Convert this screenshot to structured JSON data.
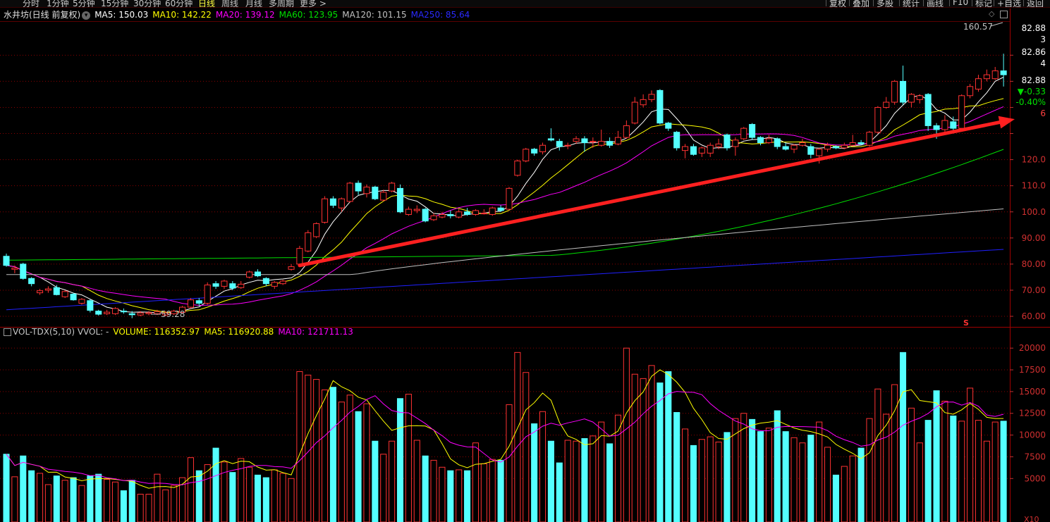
{
  "toolbar": {
    "periods": [
      "分时",
      "1分钟",
      "5分钟",
      "15分钟",
      "30分钟",
      "60分钟",
      "日线",
      "周线",
      "月线",
      "多周期",
      "更多 >"
    ],
    "active_period": "日线",
    "buttons": [
      "复权",
      "叠加",
      "多股",
      "统计",
      "画线",
      "F10",
      "标记",
      "+自选",
      "返回"
    ]
  },
  "main_info": {
    "title": "水井坊(日线 前复权)",
    "ma5": "MA5: 150.03",
    "ma10": "MA10: 142.22",
    "ma20": "MA20: 139.12",
    "ma60": "MA60: 123.95",
    "ma120": "MA120: 101.15",
    "ma250": "MA250: 85.64"
  },
  "vol_info": {
    "title": "VOL-TDX(5,10) VVOL: -",
    "volume": "VOLUME: 116352.97",
    "ma5": "MA5: 116920.88",
    "ma10": "MA10: 121711.13"
  },
  "annotations": {
    "high_label": "160.57",
    "low_label": "59.28",
    "signal_mark": "S"
  },
  "price_axis": {
    "right_labels_top": [
      "82.88",
      "3",
      "82.86",
      "4"
    ],
    "quote_price": "82.88",
    "quote_change": "▼-0.33",
    "quote_pct": "-0.40%",
    "quote_extra": "6",
    "ticks": [
      "120.0",
      "110.0",
      "100.0",
      "90.00",
      "80.00",
      "70.00",
      "60.00"
    ]
  },
  "vol_axis": {
    "ticks": [
      "20000",
      "17500",
      "15000",
      "12500",
      "10000",
      "7500",
      "5000"
    ],
    "unit": "X10"
  },
  "colors": {
    "up": "#ff3232",
    "down": "#54ffff",
    "ma5": "#ffffff",
    "ma10": "#ffff00",
    "ma20": "#ff00ff",
    "ma60": "#00e000",
    "ma120": "#c0c0c0",
    "ma250": "#2020ff",
    "grid": "#8b0000",
    "trend_arrow": "#ff2020"
  },
  "chart_data": {
    "type": "candlestick",
    "price_ylim": [
      56.5,
      172.5
    ],
    "volume_ylim": [
      0,
      20500
    ],
    "candles": [
      {
        "o": 83.0,
        "c": 79.5,
        "h": 84.0,
        "l": 79.0,
        "v": 7800
      },
      {
        "o": 78.0,
        "c": 78.5,
        "h": 79.5,
        "l": 76.5,
        "v": 5200
      },
      {
        "o": 80.0,
        "c": 74.5,
        "h": 80.5,
        "l": 74.0,
        "v": 7600
      },
      {
        "o": 74.5,
        "c": 72.5,
        "h": 75.0,
        "l": 71.5,
        "v": 5900
      },
      {
        "o": 69.0,
        "c": 69.8,
        "h": 70.5,
        "l": 68.2,
        "v": 5600
      },
      {
        "o": 70.0,
        "c": 70.5,
        "h": 71.5,
        "l": 69.0,
        "v": 4300
      },
      {
        "o": 71.0,
        "c": 68.3,
        "h": 72.0,
        "l": 68.0,
        "v": 5300
      },
      {
        "o": 67.5,
        "c": 69.5,
        "h": 70.0,
        "l": 67.0,
        "v": 4800
      },
      {
        "o": 68.5,
        "c": 66.3,
        "h": 69.0,
        "l": 66.0,
        "v": 5100
      },
      {
        "o": 65.0,
        "c": 66.5,
        "h": 67.0,
        "l": 64.5,
        "v": 4200
      },
      {
        "o": 66.0,
        "c": 62.3,
        "h": 66.5,
        "l": 61.5,
        "v": 5300
      },
      {
        "o": 62.0,
        "c": 60.8,
        "h": 62.5,
        "l": 60.3,
        "v": 5500
      },
      {
        "o": 61.0,
        "c": 61.6,
        "h": 62.5,
        "l": 60.5,
        "v": 4900
      },
      {
        "o": 61.0,
        "c": 63.0,
        "h": 63.5,
        "l": 60.5,
        "v": 4600
      },
      {
        "o": 62.0,
        "c": 61.7,
        "h": 63.0,
        "l": 61.0,
        "v": 3600
      },
      {
        "o": 61.0,
        "c": 60.6,
        "h": 62.0,
        "l": 59.3,
        "v": 4800
      },
      {
        "o": 60.5,
        "c": 61.3,
        "h": 62.0,
        "l": 60.0,
        "v": 3200
      },
      {
        "o": 61.0,
        "c": 61.4,
        "h": 62.0,
        "l": 60.4,
        "v": 3200
      },
      {
        "o": 61.0,
        "c": 61.8,
        "h": 62.5,
        "l": 60.5,
        "v": 5500
      },
      {
        "o": 60.5,
        "c": 61.3,
        "h": 62.0,
        "l": 60.0,
        "v": 3700
      },
      {
        "o": 61.0,
        "c": 62.0,
        "h": 62.5,
        "l": 60.5,
        "v": 4200
      },
      {
        "o": 61.5,
        "c": 63.5,
        "h": 64.0,
        "l": 61.0,
        "v": 5100
      },
      {
        "o": 63.5,
        "c": 66.3,
        "h": 67.0,
        "l": 63.0,
        "v": 7400
      },
      {
        "o": 66.0,
        "c": 65.0,
        "h": 67.0,
        "l": 64.0,
        "v": 5900
      },
      {
        "o": 65.0,
        "c": 72.0,
        "h": 73.0,
        "l": 64.5,
        "v": 6600
      },
      {
        "o": 72.5,
        "c": 71.5,
        "h": 73.5,
        "l": 70.5,
        "v": 8500
      },
      {
        "o": 71.5,
        "c": 73.5,
        "h": 74.0,
        "l": 70.5,
        "v": 6900
      },
      {
        "o": 72.5,
        "c": 70.8,
        "h": 73.5,
        "l": 70.0,
        "v": 5700
      },
      {
        "o": 71.0,
        "c": 72.3,
        "h": 73.5,
        "l": 70.5,
        "v": 7300
      },
      {
        "o": 75.0,
        "c": 77.0,
        "h": 77.5,
        "l": 74.5,
        "v": 6300
      },
      {
        "o": 77.0,
        "c": 75.5,
        "h": 78.0,
        "l": 75.0,
        "v": 5400
      },
      {
        "o": 74.5,
        "c": 72.5,
        "h": 75.0,
        "l": 71.5,
        "v": 5100
      },
      {
        "o": 71.5,
        "c": 73.0,
        "h": 73.5,
        "l": 70.5,
        "v": 6000
      },
      {
        "o": 72.5,
        "c": 73.5,
        "h": 74.0,
        "l": 72.0,
        "v": 5600
      },
      {
        "o": 78.0,
        "c": 79.0,
        "h": 80.0,
        "l": 77.5,
        "v": 5000
      },
      {
        "o": 80.0,
        "c": 86.0,
        "h": 87.0,
        "l": 79.5,
        "v": 17300
      },
      {
        "o": 85.0,
        "c": 92.0,
        "h": 93.0,
        "l": 84.5,
        "v": 16900
      },
      {
        "o": 90.5,
        "c": 95.5,
        "h": 96.0,
        "l": 90.0,
        "v": 16400
      },
      {
        "o": 96.0,
        "c": 105.0,
        "h": 106.0,
        "l": 95.5,
        "v": 15200
      },
      {
        "o": 105.0,
        "c": 102.5,
        "h": 106.0,
        "l": 101.5,
        "v": 15500
      },
      {
        "o": 101.5,
        "c": 105.0,
        "h": 105.5,
        "l": 100.0,
        "v": 13800
      },
      {
        "o": 104.0,
        "c": 111.0,
        "h": 111.5,
        "l": 103.5,
        "v": 14600
      },
      {
        "o": 111.0,
        "c": 108.0,
        "h": 112.0,
        "l": 106.5,
        "v": 12700
      },
      {
        "o": 107.0,
        "c": 109.5,
        "h": 110.5,
        "l": 105.5,
        "v": 13600
      },
      {
        "o": 109.5,
        "c": 105.0,
        "h": 110.0,
        "l": 104.5,
        "v": 9300
      },
      {
        "o": 104.5,
        "c": 107.5,
        "h": 108.5,
        "l": 104.0,
        "v": 7800
      },
      {
        "o": 108.0,
        "c": 111.0,
        "h": 111.5,
        "l": 107.5,
        "v": 9300
      },
      {
        "o": 109.0,
        "c": 100.0,
        "h": 110.5,
        "l": 99.5,
        "v": 14200
      },
      {
        "o": 99.0,
        "c": 101.0,
        "h": 102.0,
        "l": 98.5,
        "v": 14700
      },
      {
        "o": 100.5,
        "c": 101.0,
        "h": 102.5,
        "l": 99.5,
        "v": 9400
      },
      {
        "o": 101.0,
        "c": 96.5,
        "h": 101.5,
        "l": 96.0,
        "v": 7600
      },
      {
        "o": 97.0,
        "c": 98.5,
        "h": 99.5,
        "l": 96.5,
        "v": 7100
      },
      {
        "o": 98.0,
        "c": 99.0,
        "h": 100.0,
        "l": 97.5,
        "v": 6300
      },
      {
        "o": 99.0,
        "c": 98.5,
        "h": 100.5,
        "l": 97.5,
        "v": 5900
      },
      {
        "o": 98.0,
        "c": 100.0,
        "h": 101.0,
        "l": 97.5,
        "v": 6000
      },
      {
        "o": 100.0,
        "c": 99.0,
        "h": 101.5,
        "l": 98.5,
        "v": 5900
      },
      {
        "o": 99.0,
        "c": 100.5,
        "h": 101.0,
        "l": 98.5,
        "v": 9100
      },
      {
        "o": 99.5,
        "c": 99.5,
        "h": 101.0,
        "l": 99.0,
        "v": 6700
      },
      {
        "o": 99.0,
        "c": 101.5,
        "h": 102.0,
        "l": 98.5,
        "v": 7200
      },
      {
        "o": 101.5,
        "c": 100.5,
        "h": 102.5,
        "l": 100.0,
        "v": 7100
      },
      {
        "o": 101.0,
        "c": 109.0,
        "h": 109.5,
        "l": 100.5,
        "v": 13500
      },
      {
        "o": 114.0,
        "c": 119.5,
        "h": 120.0,
        "l": 113.5,
        "v": 19500
      },
      {
        "o": 119.5,
        "c": 124.0,
        "h": 124.5,
        "l": 119.0,
        "v": 17200
      },
      {
        "o": 124.0,
        "c": 122.5,
        "h": 124.5,
        "l": 121.5,
        "v": 11300
      },
      {
        "o": 123.0,
        "c": 125.5,
        "h": 126.5,
        "l": 122.0,
        "v": 12700
      },
      {
        "o": 128.0,
        "c": 127.5,
        "h": 132.0,
        "l": 127.0,
        "v": 9300
      },
      {
        "o": 127.0,
        "c": 125.0,
        "h": 128.0,
        "l": 123.5,
        "v": 6800
      },
      {
        "o": 125.5,
        "c": 125.5,
        "h": 126.5,
        "l": 124.0,
        "v": 9400
      },
      {
        "o": 127.0,
        "c": 128.0,
        "h": 129.0,
        "l": 126.0,
        "v": 9300
      },
      {
        "o": 128.0,
        "c": 126.5,
        "h": 129.0,
        "l": 123.0,
        "v": 9600
      },
      {
        "o": 127.0,
        "c": 127.0,
        "h": 128.5,
        "l": 124.5,
        "v": 9900
      },
      {
        "o": 125.5,
        "c": 127.0,
        "h": 131.5,
        "l": 125.0,
        "v": 11500
      },
      {
        "o": 127.0,
        "c": 125.5,
        "h": 128.5,
        "l": 124.5,
        "v": 9000
      },
      {
        "o": 126.0,
        "c": 128.5,
        "h": 131.0,
        "l": 125.5,
        "v": 12300
      },
      {
        "o": 128.5,
        "c": 133.0,
        "h": 135.0,
        "l": 128.0,
        "v": 20000
      },
      {
        "o": 134.0,
        "c": 142.0,
        "h": 144.0,
        "l": 133.5,
        "v": 17000
      },
      {
        "o": 141.0,
        "c": 143.0,
        "h": 145.0,
        "l": 140.0,
        "v": 16500
      },
      {
        "o": 143.0,
        "c": 145.0,
        "h": 146.5,
        "l": 142.0,
        "v": 18000
      },
      {
        "o": 146.5,
        "c": 134.0,
        "h": 147.0,
        "l": 133.5,
        "v": 16000
      },
      {
        "o": 134.0,
        "c": 132.0,
        "h": 134.5,
        "l": 131.0,
        "v": 17300
      },
      {
        "o": 130.5,
        "c": 124.5,
        "h": 131.0,
        "l": 123.5,
        "v": 12600
      },
      {
        "o": 123.5,
        "c": 125.0,
        "h": 126.0,
        "l": 120.5,
        "v": 10700
      },
      {
        "o": 125.0,
        "c": 122.0,
        "h": 126.0,
        "l": 121.5,
        "v": 8800
      },
      {
        "o": 122.5,
        "c": 124.5,
        "h": 125.0,
        "l": 121.0,
        "v": 9500
      },
      {
        "o": 122.5,
        "c": 125.5,
        "h": 126.5,
        "l": 121.0,
        "v": 9800
      },
      {
        "o": 125.0,
        "c": 126.0,
        "h": 128.0,
        "l": 124.0,
        "v": 9200
      },
      {
        "o": 129.5,
        "c": 124.5,
        "h": 130.0,
        "l": 123.5,
        "v": 10300
      },
      {
        "o": 125.0,
        "c": 127.5,
        "h": 128.5,
        "l": 121.5,
        "v": 11900
      },
      {
        "o": 128.0,
        "c": 132.0,
        "h": 132.5,
        "l": 127.5,
        "v": 12500
      },
      {
        "o": 133.5,
        "c": 128.5,
        "h": 134.0,
        "l": 127.5,
        "v": 11800
      },
      {
        "o": 128.5,
        "c": 126.5,
        "h": 129.0,
        "l": 125.5,
        "v": 10400
      },
      {
        "o": 126.5,
        "c": 128.0,
        "h": 129.5,
        "l": 126.0,
        "v": 10800
      },
      {
        "o": 128.0,
        "c": 125.0,
        "h": 128.5,
        "l": 124.0,
        "v": 12800
      },
      {
        "o": 125.0,
        "c": 124.0,
        "h": 126.5,
        "l": 123.5,
        "v": 10400
      },
      {
        "o": 124.0,
        "c": 125.5,
        "h": 126.0,
        "l": 122.5,
        "v": 9700
      },
      {
        "o": 125.5,
        "c": 126.5,
        "h": 128.0,
        "l": 125.0,
        "v": 9100
      },
      {
        "o": 125.0,
        "c": 122.0,
        "h": 126.0,
        "l": 120.5,
        "v": 10000
      },
      {
        "o": 121.5,
        "c": 124.0,
        "h": 124.5,
        "l": 118.5,
        "v": 11500
      },
      {
        "o": 124.0,
        "c": 125.5,
        "h": 126.5,
        "l": 123.0,
        "v": 8600
      },
      {
        "o": 125.0,
        "c": 124.5,
        "h": 125.5,
        "l": 124.0,
        "v": 5400
      },
      {
        "o": 124.5,
        "c": 125.5,
        "h": 126.5,
        "l": 124.0,
        "v": 6400
      },
      {
        "o": 125.5,
        "c": 126.5,
        "h": 129.5,
        "l": 125.0,
        "v": 7600
      },
      {
        "o": 126.5,
        "c": 126.0,
        "h": 127.5,
        "l": 125.5,
        "v": 8500
      },
      {
        "o": 125.5,
        "c": 130.5,
        "h": 131.0,
        "l": 125.0,
        "v": 11900
      },
      {
        "o": 130.5,
        "c": 140.0,
        "h": 140.5,
        "l": 130.0,
        "v": 15300
      },
      {
        "o": 140.0,
        "c": 142.0,
        "h": 144.0,
        "l": 139.5,
        "v": 12400
      },
      {
        "o": 142.0,
        "c": 150.0,
        "h": 150.5,
        "l": 141.0,
        "v": 15800
      },
      {
        "o": 150.0,
        "c": 142.0,
        "h": 156.0,
        "l": 141.0,
        "v": 19500
      },
      {
        "o": 142.0,
        "c": 145.0,
        "h": 145.5,
        "l": 140.0,
        "v": 13100
      },
      {
        "o": 143.0,
        "c": 144.5,
        "h": 145.0,
        "l": 141.5,
        "v": 9100
      },
      {
        "o": 145.0,
        "c": 133.0,
        "h": 145.5,
        "l": 131.0,
        "v": 11700
      },
      {
        "o": 133.0,
        "c": 131.5,
        "h": 134.0,
        "l": 128.0,
        "v": 15100
      },
      {
        "o": 131.5,
        "c": 135.0,
        "h": 137.0,
        "l": 130.5,
        "v": 13900
      },
      {
        "o": 134.5,
        "c": 132.0,
        "h": 136.5,
        "l": 130.0,
        "v": 12200
      },
      {
        "o": 132.0,
        "c": 144.5,
        "h": 145.0,
        "l": 131.5,
        "v": 11600
      },
      {
        "o": 144.5,
        "c": 148.0,
        "h": 149.0,
        "l": 143.5,
        "v": 15400
      },
      {
        "o": 147.0,
        "c": 151.0,
        "h": 152.5,
        "l": 146.0,
        "v": 11700
      },
      {
        "o": 151.0,
        "c": 152.5,
        "h": 154.5,
        "l": 150.0,
        "v": 9300
      },
      {
        "o": 151.0,
        "c": 154.0,
        "h": 155.5,
        "l": 150.5,
        "v": 11500
      },
      {
        "o": 154.0,
        "c": 152.5,
        "h": 160.57,
        "l": 148.0,
        "v": 11600
      }
    ]
  }
}
